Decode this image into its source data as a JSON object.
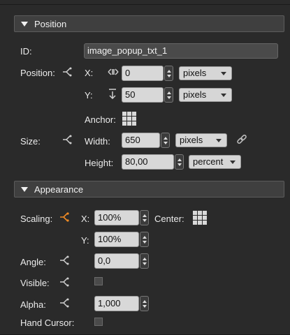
{
  "sections": {
    "position": "Position",
    "appearance": "Appearance"
  },
  "id": {
    "label": "ID:",
    "value": "image_popup_txt_1"
  },
  "position": {
    "label": "Position:",
    "x_label": "X:",
    "x_value": "0",
    "x_unit": "pixels",
    "y_label": "Y:",
    "y_value": "50",
    "y_unit": "pixels",
    "anchor_label": "Anchor:"
  },
  "size": {
    "label": "Size:",
    "width_label": "Width:",
    "width_value": "650",
    "width_unit": "pixels",
    "height_label": "Height:",
    "height_value": "80,00",
    "height_unit": "percent"
  },
  "appearance": {
    "scaling_label": "Scaling:",
    "x_label": "X:",
    "x_value": "100%",
    "center_label": "Center:",
    "y_label": "Y:",
    "y_value": "100%",
    "angle_label": "Angle:",
    "angle_value": "0,0",
    "visible_label": "Visible:",
    "alpha_label": "Alpha:",
    "alpha_value": "1,000",
    "cursor_label": "Hand Cursor:"
  },
  "colors": {
    "link_active": "#f08a24",
    "link_inactive": "#cfcfcf"
  }
}
